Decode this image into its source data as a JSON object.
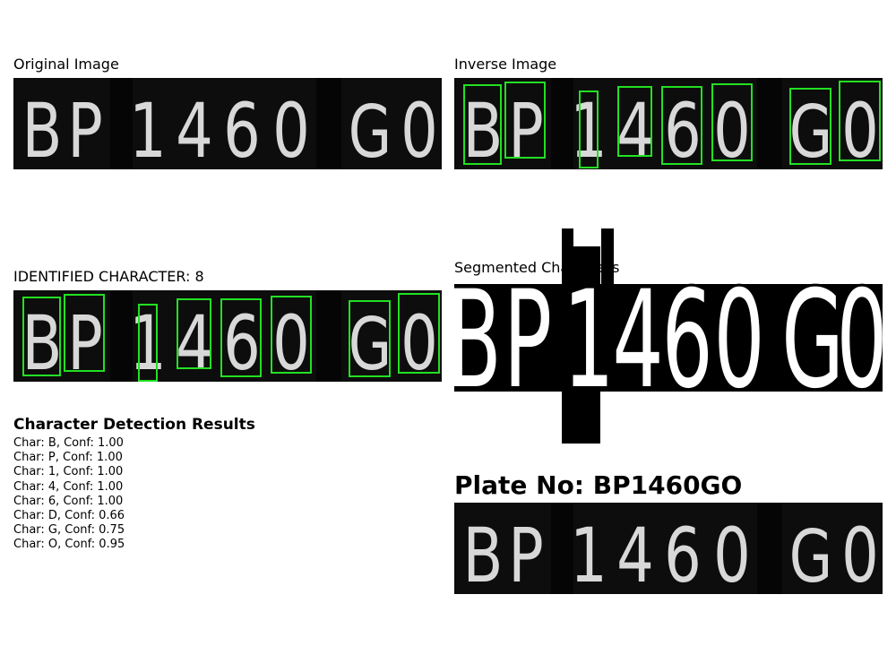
{
  "panels": {
    "original": {
      "title": "Original Image"
    },
    "inverse": {
      "title": "Inverse Image"
    },
    "identified": {
      "title": "IDENTIFIED CHARACTER: 8"
    },
    "segmented": {
      "title": "Segmented Characters"
    }
  },
  "plate_glyphs": [
    "B",
    "P",
    "1",
    "4",
    "6",
    "0",
    "G",
    "0"
  ],
  "detection": {
    "heading": "Character Detection Results",
    "results": [
      "Char: B, Conf: 1.00",
      "Char: P, Conf: 1.00",
      "Char: 1, Conf: 1.00",
      "Char: 4, Conf: 1.00",
      "Char: 6, Conf: 1.00",
      "Char: D, Conf: 0.66",
      "Char: G, Conf: 0.75",
      "Char: O, Conf: 0.95"
    ]
  },
  "plate_number": "Plate No: BP1460GO",
  "colors": {
    "box": "#22e022",
    "plate_bg": "#0d0d0d",
    "glyph": "#d8d8d8"
  }
}
